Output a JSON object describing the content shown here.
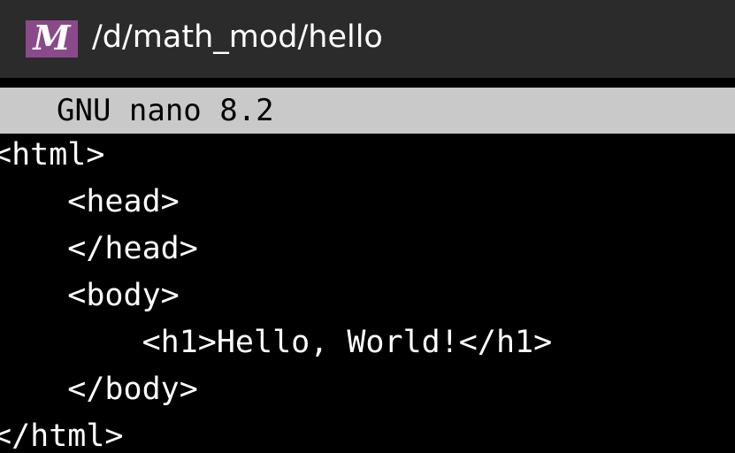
{
  "titlebar": {
    "icon": "msys2-m-icon",
    "icon_letter": "M",
    "icon_color": "#8a4a8a",
    "title": "/d/math_mod/hello"
  },
  "nano": {
    "header": "GNU nano 8.2",
    "header_bg": "#c9c9c9"
  },
  "buffer": {
    "lines": [
      "<html>",
      "    <head>",
      "    </head>",
      "    <body>",
      "        <h1>Hello, World!</h1>",
      "    </body>",
      "</html>"
    ]
  }
}
